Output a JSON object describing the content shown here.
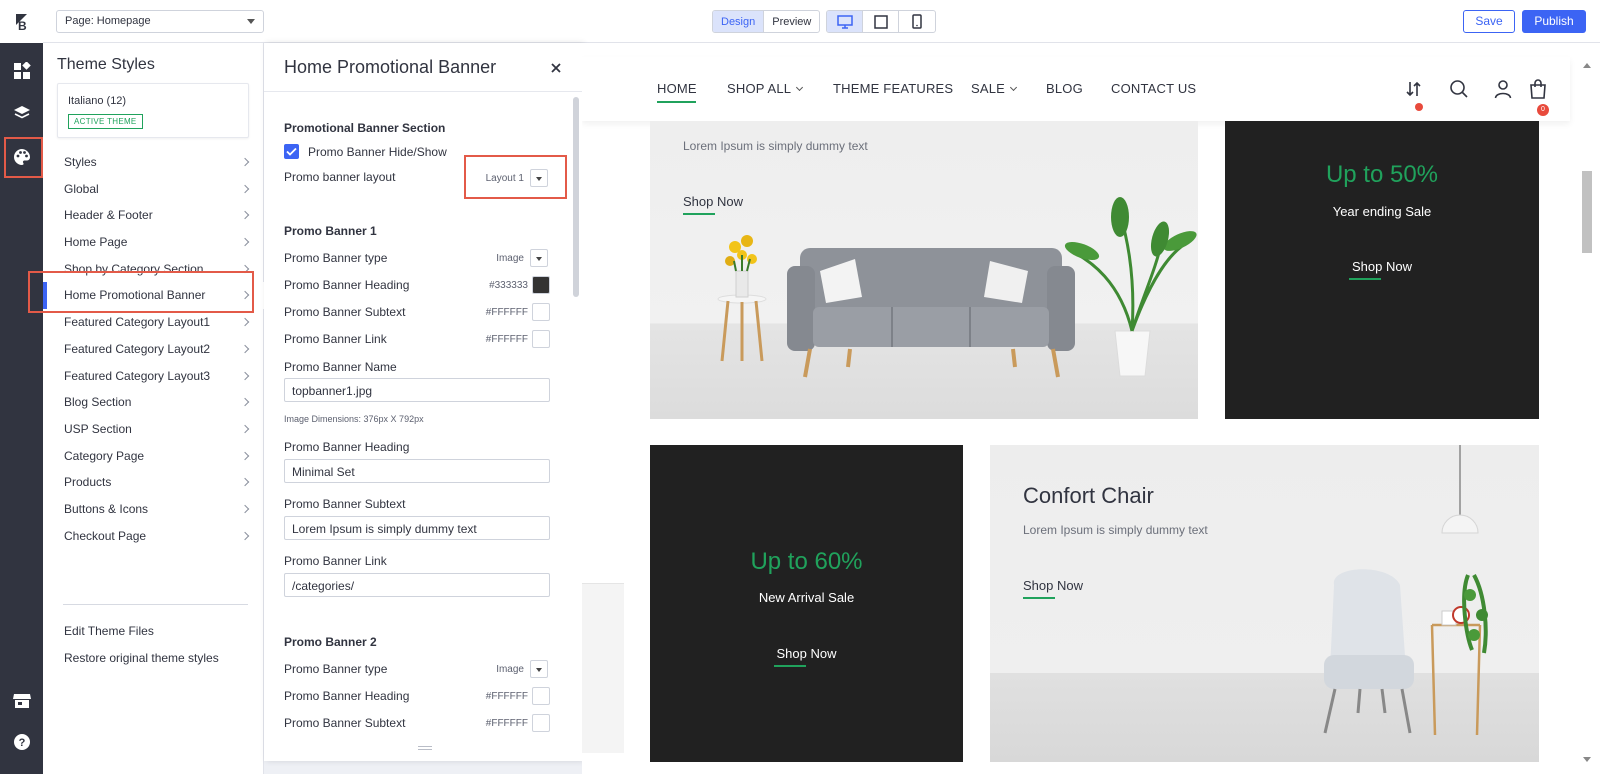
{
  "topbar": {
    "page_select": "Page: Homepage",
    "mode_tabs": [
      "Design",
      "Preview"
    ],
    "save_label": "Save",
    "publish_label": "Publish"
  },
  "sidebar": {
    "title": "Theme Styles",
    "theme_name": "Italiano (12)",
    "active_badge": "ACTIVE THEME",
    "items": [
      {
        "label": "Styles"
      },
      {
        "label": "Global"
      },
      {
        "label": "Header & Footer"
      },
      {
        "label": "Home Page"
      },
      {
        "label": "Shop by Category Section"
      },
      {
        "label": "Home Promotional Banner"
      },
      {
        "label": "Featured Category Layout1"
      },
      {
        "label": "Featured Category Layout2"
      },
      {
        "label": "Featured Category Layout3"
      },
      {
        "label": "Blog Section"
      },
      {
        "label": "USP Section"
      },
      {
        "label": "Category Page"
      },
      {
        "label": "Products"
      },
      {
        "label": "Buttons & Icons"
      },
      {
        "label": "Checkout Page"
      }
    ],
    "links": [
      "Edit Theme Files",
      "Restore original theme styles"
    ]
  },
  "panel": {
    "title": "Home Promotional Banner",
    "section_title": "Promotional Banner Section",
    "hide_show_label": "Promo Banner Hide/Show",
    "layout_label": "Promo banner layout",
    "layout_value": "Layout 1",
    "banner1": {
      "title": "Promo Banner 1",
      "type_label": "Promo Banner type",
      "type_value": "Image",
      "heading_label": "Promo Banner Heading",
      "heading_color": "#333333",
      "subtext_label": "Promo Banner Subtext",
      "subtext_color": "#FFFFFF",
      "link_label": "Promo Banner Link",
      "link_color": "#FFFFFF",
      "name_label": "Promo Banner Name",
      "name_value": "topbanner1.jpg",
      "dimensions": "Image Dimensions: 376px X 792px",
      "heading_text_label": "Promo Banner Heading",
      "heading_text_value": "Minimal Set",
      "subtext_text_label": "Promo Banner Subtext",
      "subtext_text_value": " Lorem Ipsum is simply dummy text",
      "link_text_label": "Promo Banner Link",
      "link_text_value": "/categories/"
    },
    "banner2": {
      "title": "Promo Banner 2",
      "type_label": "Promo Banner type",
      "type_value": "Image",
      "heading_label": "Promo Banner Heading",
      "heading_color": "#FFFFFF",
      "subtext_label": "Promo Banner Subtext",
      "subtext_color": "#FFFFFF"
    }
  },
  "store": {
    "nav": [
      {
        "label": "HOME"
      },
      {
        "label": "SHOP ALL"
      },
      {
        "label": "THEME FEATURES"
      },
      {
        "label": "SALE"
      },
      {
        "label": "BLOG"
      },
      {
        "label": "CONTACT US"
      }
    ],
    "cart_count": "0",
    "banner1_subtext": "Lorem Ipsum is simply dummy text",
    "banner1_cta": "Shop Now",
    "banner2_pct": "Up to 50%",
    "banner2_sub": "Year ending Sale",
    "banner2_cta": "Shop Now",
    "banner3_pct": "Up to 60%",
    "banner3_sub": "New Arrival Sale",
    "banner3_cta": "Shop Now",
    "banner4_title": "Confort Chair",
    "banner4_subtext": "Lorem Ipsum is simply dummy text",
    "banner4_cta": "Shop Now"
  },
  "colors": {
    "accent": "#3c64f4",
    "highlight": "#e35a48",
    "green": "#20a25c",
    "rail": "#313440"
  }
}
